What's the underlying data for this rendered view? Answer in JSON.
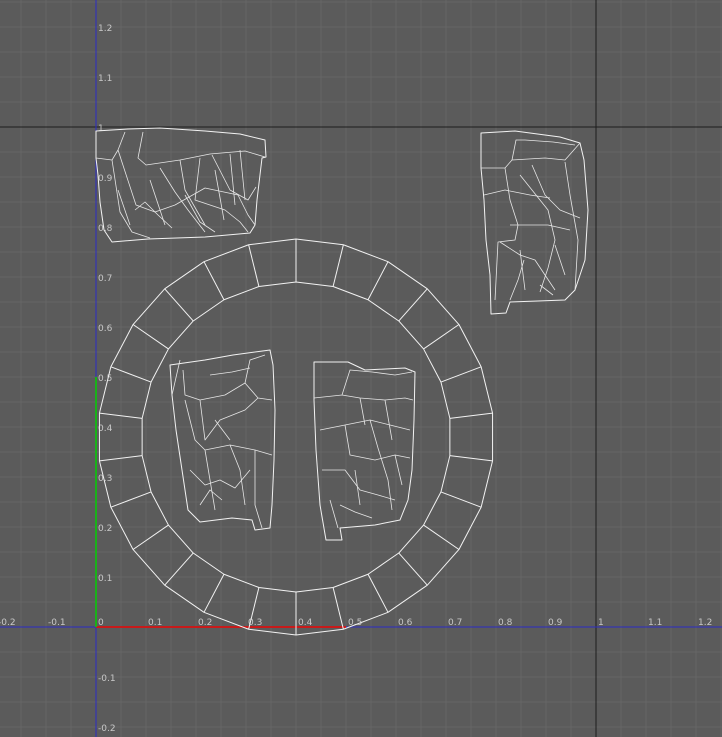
{
  "editor": {
    "title": "",
    "colors": {
      "background": "#5b5b5b",
      "grid_minor": "#666666",
      "grid_axis": "#1d1d1d",
      "u_axis": "#c81a1a",
      "v_axis": "#19b219",
      "boundary_blue": "#2b2bc4",
      "wire": "#f2f2f2",
      "tick_text": "#c8c8c8"
    }
  },
  "axes": {
    "x_ticks": [
      "-0.2",
      "-0.1",
      "0",
      "0.1",
      "0.2",
      "0.3",
      "0.4",
      "0.5",
      "0.6",
      "0.7",
      "0.8",
      "0.9",
      "1",
      "1.1",
      "1.2"
    ],
    "y_ticks": [
      "1.2",
      "1.1",
      "1",
      "0.9",
      "0.8",
      "0.7",
      "0.6",
      "0.5",
      "0.4",
      "0.3",
      "0.2",
      "0.1",
      "-0.1",
      "-0.2"
    ]
  },
  "uv_shells": [
    {
      "name": "top-left-shell",
      "icon": "mesh-wireframe"
    },
    {
      "name": "top-right-shell",
      "icon": "mesh-wireframe"
    },
    {
      "name": "circular-ring-shell",
      "icon": "mesh-wireframe"
    },
    {
      "name": "center-left-shell",
      "icon": "mesh-wireframe"
    },
    {
      "name": "center-right-shell",
      "icon": "mesh-wireframe"
    }
  ]
}
